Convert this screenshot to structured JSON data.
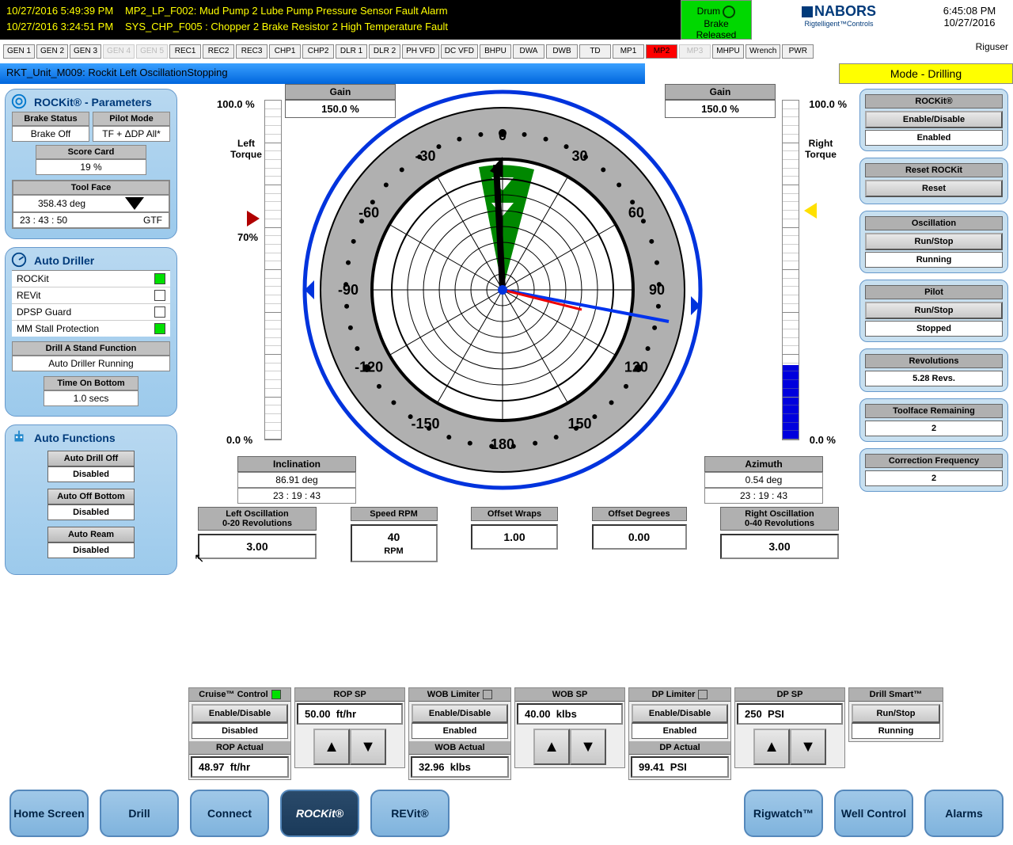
{
  "alarms": [
    {
      "time": "10/27/2016 5:49:39 PM",
      "msg": "MP2_LP_F002: Mud Pump 2 Lube Pump Pressure Sensor Fault Alarm"
    },
    {
      "time": "10/27/2016 3:24:51 PM",
      "msg": "SYS_CHP_F005 : Chopper 2 Brake Resistor 2 High Temperature Fault"
    }
  ],
  "drum_brake": {
    "line1": "Drum",
    "line2": "Brake",
    "line3": "Released"
  },
  "brand": {
    "name": "NABORS",
    "tag": "Rigtelligent™Controls"
  },
  "clock": {
    "time": "6:45:08 PM",
    "date": "10/27/2016"
  },
  "riguser": "Riguser",
  "tabs": [
    "GEN 1",
    "GEN 2",
    "GEN 3",
    "GEN 4",
    "GEN 5",
    "REC1",
    "REC2",
    "REC3",
    "CHP1",
    "CHP2",
    "DLR 1",
    "DLR 2",
    "PH VFD",
    "DC VFD",
    "BHPU",
    "DWA",
    "DWB",
    "TD",
    "MP1",
    "MP2",
    "MP3",
    "MHPU",
    "Wrench",
    "PWR"
  ],
  "tab_faded": [
    3,
    4,
    20
  ],
  "tab_red": [
    19
  ],
  "status_message": "RKT_Unit_M009: Rockit Left OscillationStopping",
  "mode": "Mode - Drilling",
  "rockit_params": {
    "title": "ROCKit® - Parameters",
    "brake_status_h": "Brake Status",
    "brake_status": "Brake Off",
    "pilot_mode_h": "Pilot Mode",
    "pilot_mode": "TF + ΔDP All*",
    "score_h": "Score Card",
    "score": "19    %",
    "toolface_h": "Tool Face",
    "toolface_deg": "358.43 deg",
    "toolface_time": "23 : 43 : 50",
    "toolface_type": "GTF"
  },
  "auto_driller": {
    "title": "Auto Driller",
    "rows": [
      {
        "label": "ROCKit",
        "on": true
      },
      {
        "label": "REVit",
        "on": false
      },
      {
        "label": "DPSP Guard",
        "on": false
      },
      {
        "label": "MM Stall Protection",
        "on": true
      }
    ],
    "stand_h": "Drill A Stand Function",
    "stand": "Auto Driller Running",
    "tob_h": "Time On Bottom",
    "tob": "1.0     secs"
  },
  "auto_functions": {
    "title": "Auto Functions",
    "items": [
      {
        "btn": "Auto Drill Off",
        "val": "Disabled"
      },
      {
        "btn": "Auto Off Bottom",
        "val": "Disabled"
      },
      {
        "btn": "Auto Ream",
        "val": "Disabled"
      }
    ]
  },
  "right": {
    "rockit": {
      "h": "ROCKit®",
      "btn": "Enable/Disable",
      "val": "Enabled"
    },
    "reset": {
      "h": "Reset ROCKit",
      "btn": "Reset"
    },
    "osc": {
      "h": "Oscillation",
      "btn": "Run/Stop",
      "val": "Running"
    },
    "pilot": {
      "h": "Pilot",
      "btn": "Run/Stop",
      "val": "Stopped"
    },
    "revs": {
      "h": "Revolutions",
      "val": "5.28  Revs."
    },
    "tfr": {
      "h": "Toolface Remaining",
      "val": "2"
    },
    "cf": {
      "h": "Correction Frequency",
      "val": "2"
    }
  },
  "center": {
    "gain_h": "Gain",
    "gain_left": "150.0    %",
    "gain_right": "150.0    %",
    "left_torque": "Left\nTorque",
    "right_torque": "Right\nTorque",
    "p100": "100.0 %",
    "p70": "70%",
    "p0": "0.0 %",
    "inc": {
      "h": "Inclination",
      "deg": "86.91 deg",
      "t": "23 :  19 :  43"
    },
    "azi": {
      "h": "Azimuth",
      "deg": "0.54 deg",
      "t": "23 :  19 :  43"
    },
    "dial_ticks": [
      "0",
      "30",
      "60",
      "90",
      "120",
      "150",
      "180",
      "-150",
      "-120",
      "-90",
      "-60",
      "-30"
    ]
  },
  "osc_row": {
    "left": {
      "h1": "Left Oscillation",
      "h2": "0-20 Revolutions",
      "val": "3.00"
    },
    "speed": {
      "h": "Speed RPM",
      "val": "40",
      "unit": "RPM"
    },
    "wraps": {
      "h": "Offset Wraps",
      "val": "1.00"
    },
    "deg": {
      "h": "Offset Degrees",
      "val": "0.00"
    },
    "right": {
      "h1": "Right Oscillation",
      "h2": "0-40 Revolutions",
      "val": "3.00"
    }
  },
  "drill": {
    "cruise": {
      "h": "Cruise™ Control",
      "btn": "Enable/Disable",
      "val": "Disabled",
      "ind": true
    },
    "ropsp": {
      "h": "ROP SP",
      "val": "50.00",
      "unit": "ft/hr"
    },
    "ropact": {
      "h": "ROP Actual",
      "val": "48.97",
      "unit": "ft/hr"
    },
    "woblim": {
      "h": "WOB Limiter",
      "btn": "Enable/Disable",
      "val": "Enabled",
      "ind": false
    },
    "wobsp": {
      "h": "WOB SP",
      "val": "40.00",
      "unit": "klbs"
    },
    "wobact": {
      "h": "WOB Actual",
      "val": "32.96",
      "unit": "klbs"
    },
    "dplim": {
      "h": "DP Limiter",
      "btn": "Enable/Disable",
      "val": "Enabled",
      "ind": false
    },
    "dpsp": {
      "h": "DP SP",
      "val": "250",
      "unit": "PSI"
    },
    "dpact": {
      "h": "DP Actual",
      "val": "99.41",
      "unit": "PSI"
    },
    "smart": {
      "h": "Drill Smart™",
      "btn": "Run/Stop",
      "val": "Running"
    }
  },
  "nav": [
    "Home Screen",
    "Drill",
    "Connect",
    "ROCKit®",
    "REVit®",
    "Rigwatch™",
    "Well Control",
    "Alarms"
  ],
  "nav_active": 3,
  "chart_data": {
    "type": "gauge",
    "title": "Toolface / Torque Dial",
    "angle_range": [
      -180,
      180
    ],
    "tick_labels": [
      -150,
      -120,
      -90,
      -60,
      -30,
      0,
      30,
      60,
      90,
      120,
      150,
      180
    ],
    "needle_black_deg": -5,
    "needle_blue_deg": 100,
    "needle_red_deg": 105,
    "green_wedge_deg": [
      -20,
      15
    ],
    "left_torque_gain_pct": 100.0,
    "right_torque_gain_pct": 100.0,
    "left_bar_pct": 0.0,
    "right_bar_pct": 22.0,
    "red_marker_left_pct": 70,
    "yellow_marker_right_pct": 70
  }
}
